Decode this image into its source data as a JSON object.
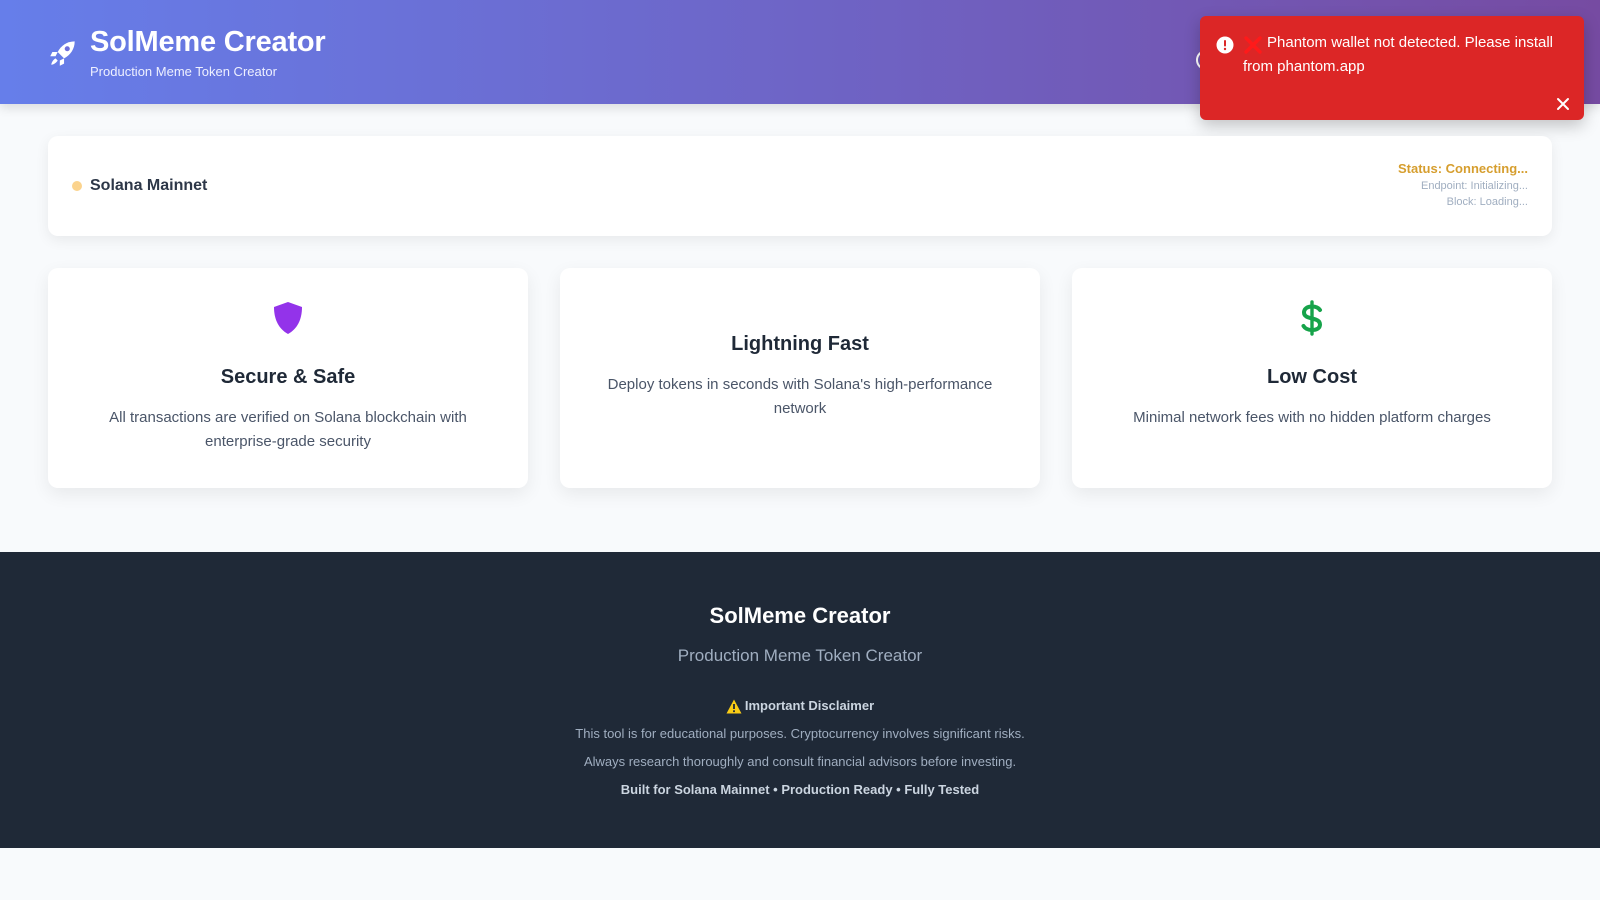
{
  "header": {
    "title": "SolMeme Creator",
    "subtitle": "Production Meme Token Creator",
    "logo_icon": "rocket-icon"
  },
  "toast": {
    "message": "Phantom wallet not detected. Please install from phantom.app",
    "icons": [
      "alert-circle-icon",
      "red-x-icon",
      "close-icon"
    ],
    "color": "#dc2626"
  },
  "network": {
    "name": "Solana Mainnet",
    "status": "Status: Connecting...",
    "endpoint": "Endpoint: Initializing...",
    "block": "Block: Loading...",
    "status_color": "#d69e2e"
  },
  "features": [
    {
      "icon": "shield-icon",
      "title": "Secure & Safe",
      "description": "All transactions are verified on Solana blockchain with enterprise-grade security"
    },
    {
      "icon": "",
      "title": "Lightning Fast",
      "description": "Deploy tokens in seconds with Solana's high-performance network"
    },
    {
      "icon": "dollar-icon",
      "title": "Low Cost",
      "description": "Minimal network fees with no hidden platform charges"
    }
  ],
  "footer": {
    "title": "SolMeme Creator",
    "subtitle": "Production Meme Token Creator",
    "disclaimer_title": "Important Disclaimer",
    "disclaimer_line1": "This tool is for educational purposes. Cryptocurrency involves significant risks.",
    "disclaimer_line2": "Always research thoroughly and consult financial advisors before investing.",
    "built": "Built for Solana Mainnet • Production Ready • Fully Tested"
  },
  "colors": {
    "header_gradient_start": "#667eea",
    "header_gradient_end": "#764ba2",
    "shield": "#9333ea",
    "dollar": "#16a34a",
    "footer_bg": "#1f2937"
  }
}
